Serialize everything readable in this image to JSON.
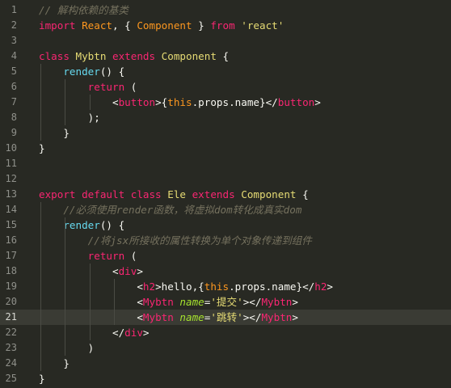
{
  "theme": {
    "background": "#282923",
    "current_line": "#3a3b34",
    "gutter_text": "#8f908a",
    "keyword": "#f92672",
    "string": "#e6db74",
    "comment": "#75715e",
    "function": "#66d9ef",
    "attribute": "#a6e22e",
    "identifier": "#fd971f",
    "plain": "#f8f8f2"
  },
  "editor": {
    "current_line_number": "21",
    "lines": [
      {
        "number": "1",
        "tokens": [
          {
            "t": "comment",
            "v": "// 解构依赖的基类"
          }
        ]
      },
      {
        "number": "2",
        "tokens": [
          {
            "t": "kw",
            "v": "import "
          },
          {
            "t": "ident",
            "v": "React"
          },
          {
            "t": "plain",
            "v": ", { "
          },
          {
            "t": "ident",
            "v": "Component"
          },
          {
            "t": "plain",
            "v": " } "
          },
          {
            "t": "kw",
            "v": "from "
          },
          {
            "t": "string",
            "v": "'react'"
          }
        ]
      },
      {
        "number": "3",
        "tokens": []
      },
      {
        "number": "4",
        "tokens": [
          {
            "t": "kw",
            "v": "class "
          },
          {
            "t": "cls",
            "v": "Mybtn "
          },
          {
            "t": "kw",
            "v": "extends "
          },
          {
            "t": "cls",
            "v": "Component"
          },
          {
            "t": "plain",
            "v": " {"
          }
        ]
      },
      {
        "number": "5",
        "tokens": [
          {
            "t": "plain",
            "v": "    "
          },
          {
            "t": "fn",
            "v": "render"
          },
          {
            "t": "plain",
            "v": "() {"
          }
        ]
      },
      {
        "number": "6",
        "tokens": [
          {
            "t": "plain",
            "v": "        "
          },
          {
            "t": "kw",
            "v": "return"
          },
          {
            "t": "plain",
            "v": " ("
          }
        ]
      },
      {
        "number": "7",
        "tokens": [
          {
            "t": "plain",
            "v": "            <"
          },
          {
            "t": "tag",
            "v": "button"
          },
          {
            "t": "plain",
            "v": ">{"
          },
          {
            "t": "this",
            "v": "this"
          },
          {
            "t": "plain",
            "v": ".props.name}</"
          },
          {
            "t": "tag",
            "v": "button"
          },
          {
            "t": "plain",
            "v": ">"
          }
        ]
      },
      {
        "number": "8",
        "tokens": [
          {
            "t": "plain",
            "v": "        );"
          }
        ]
      },
      {
        "number": "9",
        "tokens": [
          {
            "t": "plain",
            "v": "    }"
          }
        ]
      },
      {
        "number": "10",
        "tokens": [
          {
            "t": "plain",
            "v": "}"
          }
        ]
      },
      {
        "number": "11",
        "tokens": []
      },
      {
        "number": "12",
        "tokens": []
      },
      {
        "number": "13",
        "tokens": [
          {
            "t": "kw",
            "v": "export default class "
          },
          {
            "t": "cls",
            "v": "Ele "
          },
          {
            "t": "kw",
            "v": "extends "
          },
          {
            "t": "cls",
            "v": "Component"
          },
          {
            "t": "plain",
            "v": " {"
          }
        ]
      },
      {
        "number": "14",
        "tokens": [
          {
            "t": "plain",
            "v": "    "
          },
          {
            "t": "comment",
            "v": "//必须使用render函数，将虚拟dom转化成真实dom"
          }
        ]
      },
      {
        "number": "15",
        "tokens": [
          {
            "t": "plain",
            "v": "    "
          },
          {
            "t": "fn",
            "v": "render"
          },
          {
            "t": "plain",
            "v": "() {"
          }
        ]
      },
      {
        "number": "16",
        "tokens": [
          {
            "t": "plain",
            "v": "        "
          },
          {
            "t": "comment",
            "v": "//将jsx所接收的属性转换为单个对象传递到组件"
          }
        ]
      },
      {
        "number": "17",
        "tokens": [
          {
            "t": "plain",
            "v": "        "
          },
          {
            "t": "kw",
            "v": "return"
          },
          {
            "t": "plain",
            "v": " ("
          }
        ]
      },
      {
        "number": "18",
        "tokens": [
          {
            "t": "plain",
            "v": "            <"
          },
          {
            "t": "tag",
            "v": "div"
          },
          {
            "t": "plain",
            "v": ">"
          }
        ]
      },
      {
        "number": "19",
        "tokens": [
          {
            "t": "plain",
            "v": "                <"
          },
          {
            "t": "tag",
            "v": "h2"
          },
          {
            "t": "plain",
            "v": ">hello,{"
          },
          {
            "t": "this",
            "v": "this"
          },
          {
            "t": "plain",
            "v": ".props.name}</"
          },
          {
            "t": "tag",
            "v": "h2"
          },
          {
            "t": "plain",
            "v": ">"
          }
        ]
      },
      {
        "number": "20",
        "tokens": [
          {
            "t": "plain",
            "v": "                <"
          },
          {
            "t": "tag",
            "v": "Mybtn "
          },
          {
            "t": "attr",
            "v": "name"
          },
          {
            "t": "plain",
            "v": "="
          },
          {
            "t": "string",
            "v": "'提交'"
          },
          {
            "t": "plain",
            "v": "></"
          },
          {
            "t": "tag",
            "v": "Mybtn"
          },
          {
            "t": "plain",
            "v": ">"
          }
        ]
      },
      {
        "number": "21",
        "tokens": [
          {
            "t": "plain",
            "v": "                <"
          },
          {
            "t": "tag",
            "v": "Mybtn "
          },
          {
            "t": "attr",
            "v": "name"
          },
          {
            "t": "plain",
            "v": "="
          },
          {
            "t": "string",
            "v": "'跳转'"
          },
          {
            "t": "plain",
            "v": "></"
          },
          {
            "t": "tag",
            "v": "Mybtn"
          },
          {
            "t": "plain",
            "v": ">"
          }
        ]
      },
      {
        "number": "22",
        "tokens": [
          {
            "t": "plain",
            "v": "            </"
          },
          {
            "t": "tag",
            "v": "div"
          },
          {
            "t": "plain",
            "v": ">"
          }
        ]
      },
      {
        "number": "23",
        "tokens": [
          {
            "t": "plain",
            "v": "        )"
          }
        ]
      },
      {
        "number": "24",
        "tokens": [
          {
            "t": "plain",
            "v": "    }"
          }
        ]
      },
      {
        "number": "25",
        "tokens": [
          {
            "t": "plain",
            "v": "}"
          }
        ]
      }
    ]
  }
}
